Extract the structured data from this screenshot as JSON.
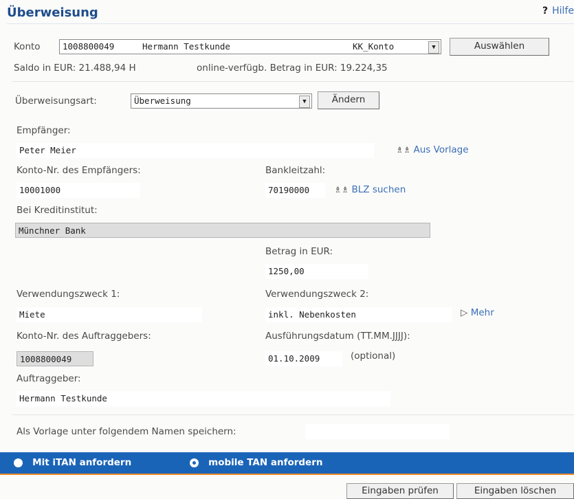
{
  "header": {
    "title": "Überweisung",
    "help_label": "Hilfe",
    "help_icon": "?"
  },
  "account": {
    "label": "Konto",
    "number": "1008800049",
    "holder": "Hermann Testkunde",
    "type": "KK_Konto",
    "select_button": "Auswählen",
    "saldo_text": "Saldo in EUR:  21.488,94 H",
    "available_text": "online-verfügb. Betrag in EUR:  19.224,35"
  },
  "transfer_type": {
    "label": "Überweisungsart:",
    "value": "Überweisung",
    "change_button": "Ändern"
  },
  "form": {
    "recipient_label": "Empfänger:",
    "recipient_value": "Peter Meier",
    "template_link": "Aus Vorlage",
    "recipient_account_label": "Konto-Nr. des Empfängers:",
    "recipient_account_value": "10001000",
    "blz_label": "Bankleitzahl:",
    "blz_value": "70190000",
    "blz_search_link": "BLZ suchen",
    "bank_label": "Bei Kreditinstitut:",
    "bank_value": "Münchner Bank",
    "amount_label": "Betrag in EUR:",
    "amount_value": "1250,00",
    "purpose1_label": "Verwendungszweck 1:",
    "purpose1_value": "Miete",
    "purpose2_label": "Verwendungszweck 2:",
    "purpose2_value": "inkl. Nebenkosten",
    "more_link": "Mehr",
    "orderer_account_label": "Konto-Nr. des Auftraggebers:",
    "orderer_account_value": "1008800049",
    "execution_date_label": "Ausführungsdatum (TT.MM.JJJJ):",
    "execution_date_value": "01.10.2009",
    "optional_hint": "(optional)",
    "orderer_label": "Auftraggeber:",
    "orderer_value": "Hermann Testkunde",
    "save_template_label": "Als Vorlage unter folgendem Namen speichern:",
    "save_template_value": ""
  },
  "tan": {
    "itan_label": "Mit iTAN anfordern",
    "mobile_label": "mobile TAN anfordern",
    "selected": "mobile"
  },
  "actions": {
    "check_button": "Eingaben prüfen",
    "clear_button": "Eingaben löschen"
  },
  "colors": {
    "accent_blue": "#1a64b8",
    "title_blue": "#1e4d8c",
    "link_blue": "#3a6eb5",
    "orange": "#f08a2a"
  }
}
